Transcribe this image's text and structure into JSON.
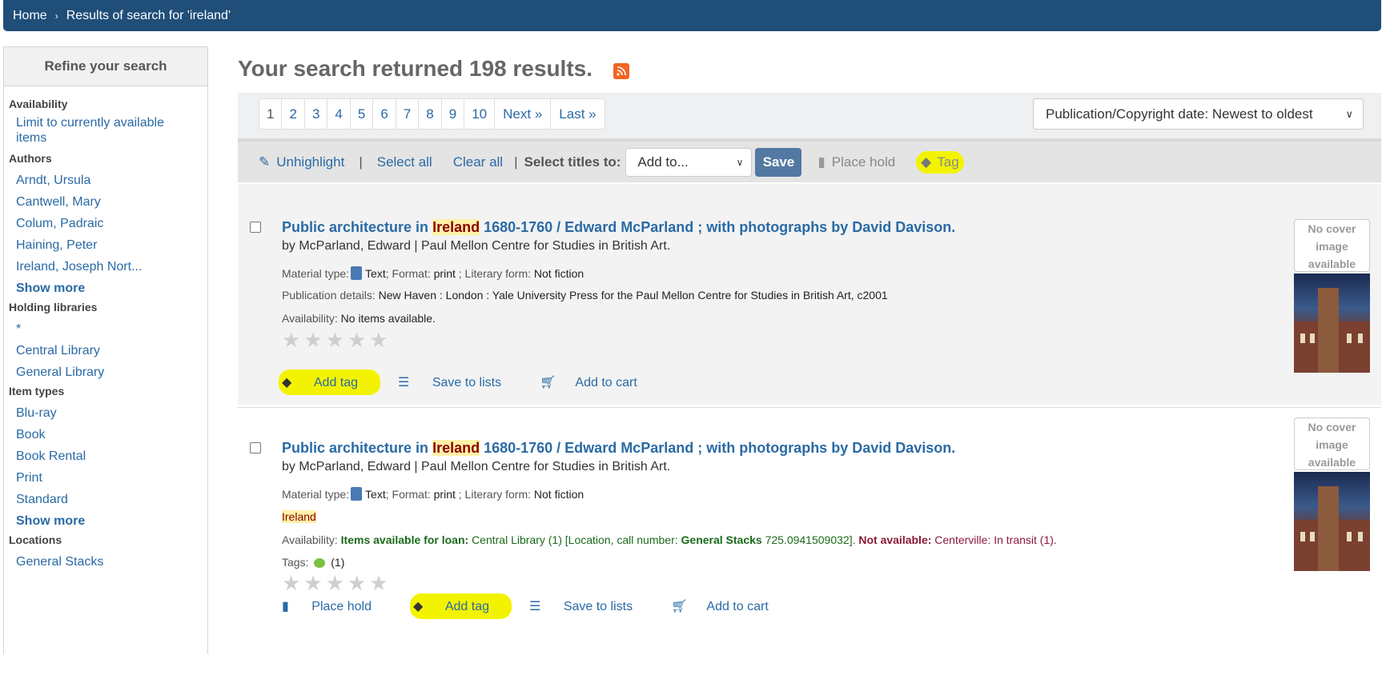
{
  "breadcrumb": {
    "home": "Home",
    "current": "Results of search for 'ireland'"
  },
  "sidebar": {
    "heading": "Refine your search",
    "sections": {
      "availability": {
        "title": "Availability",
        "items": [
          "Limit to currently available",
          "items"
        ]
      },
      "authors": {
        "title": "Authors",
        "items": [
          "Arndt, Ursula",
          "Cantwell, Mary",
          "Colum, Padraic",
          "Haining, Peter",
          "Ireland, Joseph Nort..."
        ],
        "more": "Show more"
      },
      "libraries": {
        "title": "Holding libraries",
        "items": [
          "*",
          "Central Library",
          "General Library"
        ]
      },
      "itemtypes": {
        "title": "Item types",
        "items": [
          "Blu-ray",
          "Book",
          "Book Rental",
          "Print",
          "Standard"
        ],
        "more": "Show more"
      },
      "locations": {
        "title": "Locations",
        "items": [
          "General Stacks"
        ]
      }
    }
  },
  "main": {
    "heading": "Your search returned 198 results.",
    "pages": [
      "1",
      "2",
      "3",
      "4",
      "5",
      "6",
      "7",
      "8",
      "9",
      "10"
    ],
    "next": "Next »",
    "last": "Last »",
    "sort": "Publication/Copyright date: Newest to oldest"
  },
  "toolbar": {
    "unhighlight": "Unhighlight",
    "select_all": "Select all",
    "clear_all": "Clear all",
    "select_titles": "Select titles to:",
    "add_to": "Add to...",
    "save": "Save",
    "place_hold": "Place hold",
    "tag": "Tag"
  },
  "results": [
    {
      "title_pre": "Public architecture in ",
      "title_kw": "Ireland",
      "title_post": " 1680-1760 / Edward McParland ; with photographs by David Davison.",
      "byline": "by McParland, Edward | Paul Mellon Centre for Studies in British Art.",
      "material_label": "Material type:",
      "material_value": "Text",
      "format_label": "; Format:",
      "format_value": "print",
      "literary_label": "; Literary form:",
      "literary_value": "Not fiction",
      "pub_label": "Publication details:",
      "pub_value": "New Haven : London : Yale University Press for the Paul Mellon Centre for Studies in British Art, c2001",
      "avail_label": "Availability:",
      "avail_value": "No items available.",
      "actions": [
        "Add tag",
        "Save to lists",
        "Add to cart"
      ],
      "nocover": [
        "No cover",
        "image",
        "available"
      ]
    },
    {
      "title_pre": "Public architecture in ",
      "title_kw": "Ireland",
      "title_post": " 1680-1760 / Edward McParland ; with photographs by David Davison.",
      "byline": "by McParland, Edward | Paul Mellon Centre for Studies in British Art.",
      "material_label": "Material type:",
      "material_value": "Text",
      "format_label": "; Format:",
      "format_value": "print",
      "literary_label": "; Literary form:",
      "literary_value": "Not fiction",
      "subject": "Ireland",
      "avail_label": "Availability:",
      "avail_loan": "Items available for loan:",
      "avail_central": "Central Library (1) [Location, call number:",
      "avail_stacks": "General Stacks",
      "avail_call": "725.0941509032].",
      "avail_na": "Not available:",
      "avail_transit": "Centerville: In transit (1).",
      "tags_label": "Tags:",
      "tags_count": "(1)",
      "actions": [
        "Place hold",
        "Add tag",
        "Save to lists",
        "Add to cart"
      ],
      "nocover": [
        "No cover",
        "image",
        "available"
      ]
    }
  ],
  "colors": {
    "header": "#1f4e79",
    "link": "#2a6aa5",
    "highlight": "#f3f300",
    "save": "#5379a3"
  }
}
